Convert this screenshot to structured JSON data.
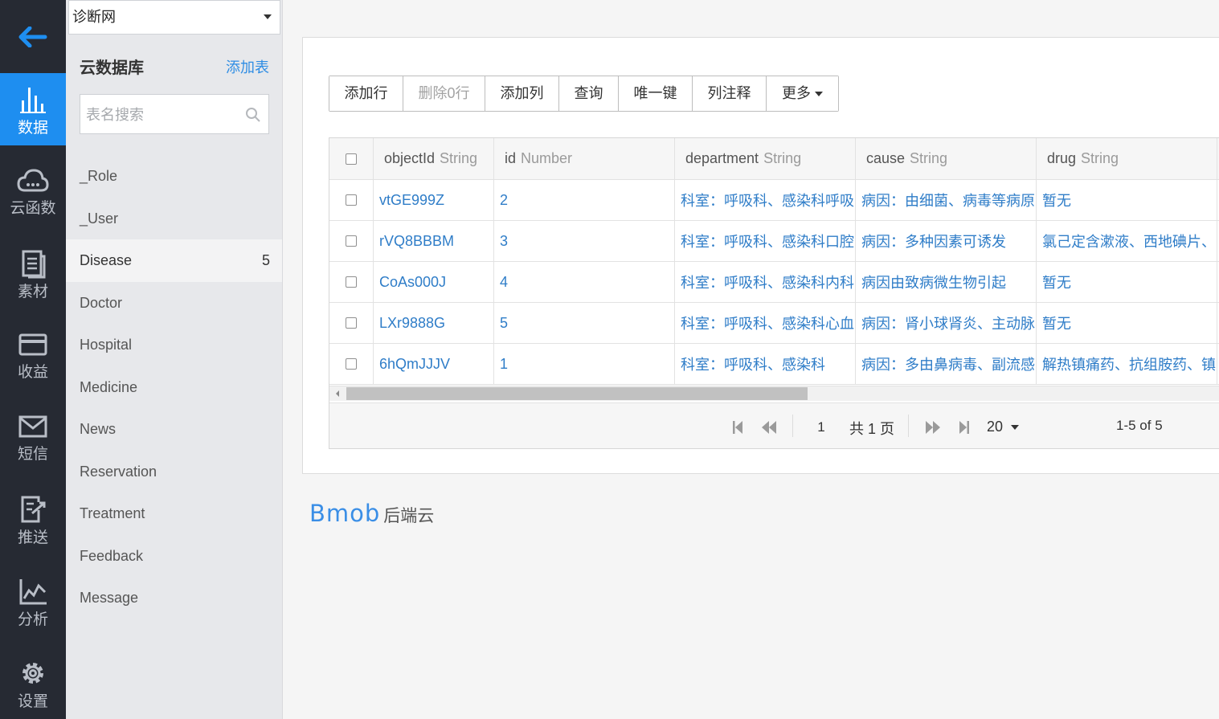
{
  "rail": {
    "items": [
      {
        "label": "数据",
        "icon": "bar-chart-icon",
        "active": true
      },
      {
        "label": "云函数",
        "icon": "cloud-icon"
      },
      {
        "label": "素材",
        "icon": "document-icon"
      },
      {
        "label": "收益",
        "icon": "card-icon"
      },
      {
        "label": "短信",
        "icon": "mail-icon"
      },
      {
        "label": "推送",
        "icon": "push-icon"
      },
      {
        "label": "分析",
        "icon": "line-chart-icon"
      },
      {
        "label": "设置",
        "icon": "gear-icon"
      }
    ]
  },
  "sidebar": {
    "app_select": "诊断网",
    "title": "云数据库",
    "add_table": "添加表",
    "search_placeholder": "表名搜索",
    "tables": [
      {
        "name": "_Role"
      },
      {
        "name": "_User"
      },
      {
        "name": "Disease",
        "count": "5",
        "active": true
      },
      {
        "name": "Doctor"
      },
      {
        "name": "Hospital"
      },
      {
        "name": "Medicine"
      },
      {
        "name": "News"
      },
      {
        "name": "Reservation"
      },
      {
        "name": "Treatment"
      },
      {
        "name": "Feedback"
      },
      {
        "name": "Message"
      }
    ]
  },
  "toolbar": {
    "add_row": "添加行",
    "delete_rows": "删除0行",
    "add_column": "添加列",
    "query": "查询",
    "unique_key": "唯一键",
    "column_comment": "列注释",
    "more": "更多"
  },
  "grid": {
    "columns": [
      {
        "name": "objectId",
        "type": "String"
      },
      {
        "name": "id",
        "type": "Number"
      },
      {
        "name": "department",
        "type": "String"
      },
      {
        "name": "cause",
        "type": "String"
      },
      {
        "name": "drug",
        "type": "String"
      }
    ],
    "rows": [
      [
        "vtGE999Z",
        "2",
        "科室：呼吸科、感染科呼吸",
        "病因：由细菌、病毒等病原",
        "暂无"
      ],
      [
        "rVQ8BBBM",
        "3",
        "科室：呼吸科、感染科口腔",
        "病因：多种因素可诱发",
        "氯己定含漱液、西地碘片、"
      ],
      [
        "CoAs000J",
        "4",
        "科室：呼吸科、感染科内科",
        "病因由致病微生物引起",
        "暂无"
      ],
      [
        "LXr9888G",
        "5",
        "科室：呼吸科、感染科心血",
        "病因：肾小球肾炎、主动脉",
        "暂无"
      ],
      [
        "6hQmJJJV",
        "1",
        "科室：呼吸科、感染科",
        "病因：多由鼻病毒、副流感",
        "解热镇痛药、抗组胺药、镇"
      ]
    ]
  },
  "pager": {
    "page": "1",
    "total_pages": "共 1 页",
    "page_size": "20",
    "range": "1-5 of 5"
  },
  "brand": {
    "logo": "Bmob",
    "sub": "后端云"
  },
  "colors": {
    "rail_bg": "#262a33",
    "active": "#1e8ef0",
    "link": "#2f7dc8"
  }
}
